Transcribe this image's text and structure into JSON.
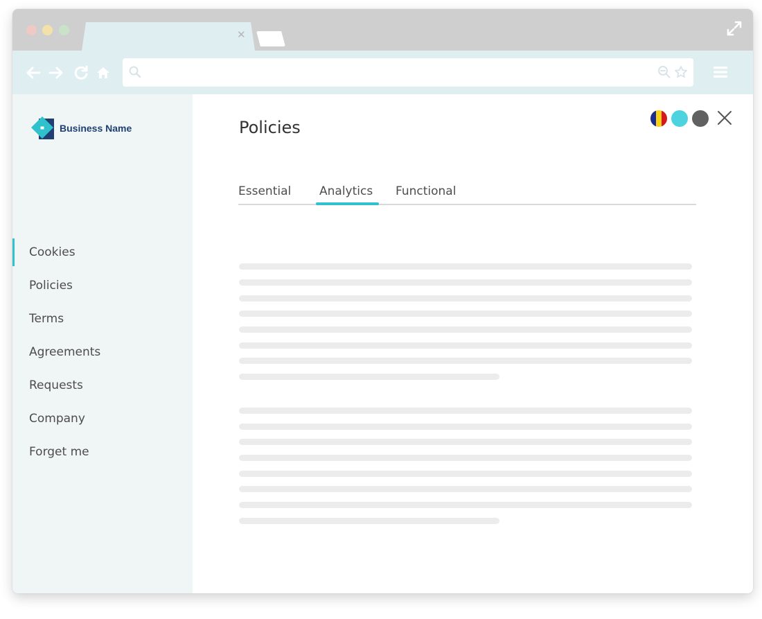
{
  "browser": {
    "url": "",
    "icons": [
      "back-arrow-icon",
      "forward-arrow-icon",
      "reload-icon",
      "home-icon",
      "search-icon",
      "zoom-icon",
      "star-icon",
      "menu-icon",
      "expand-icon",
      "close-tab-icon"
    ]
  },
  "sidebar": {
    "brand": "Business Name",
    "items": [
      {
        "label": "Cookies",
        "active": true
      },
      {
        "label": "Policies",
        "active": false
      },
      {
        "label": "Terms",
        "active": false
      },
      {
        "label": "Agreements",
        "active": false
      },
      {
        "label": "Requests",
        "active": false
      },
      {
        "label": "Company",
        "active": false
      },
      {
        "label": "Forget me",
        "active": false
      }
    ]
  },
  "main": {
    "title": "Policies",
    "tabs": [
      {
        "label": "Essential",
        "active": false
      },
      {
        "label": "Analytics",
        "active": true
      },
      {
        "label": "Functional",
        "active": false
      }
    ],
    "language_options": [
      "flag-icon",
      "teal-circle",
      "grey-circle"
    ]
  },
  "colors": {
    "accent": "#2fc2cc",
    "brand": "#1f3f73",
    "sidebar_bg": "#f0f5f6",
    "chrome_bar": "#dfeef1",
    "flag": [
      "#1a2c8f",
      "#f7d018",
      "#d6171b"
    ]
  }
}
